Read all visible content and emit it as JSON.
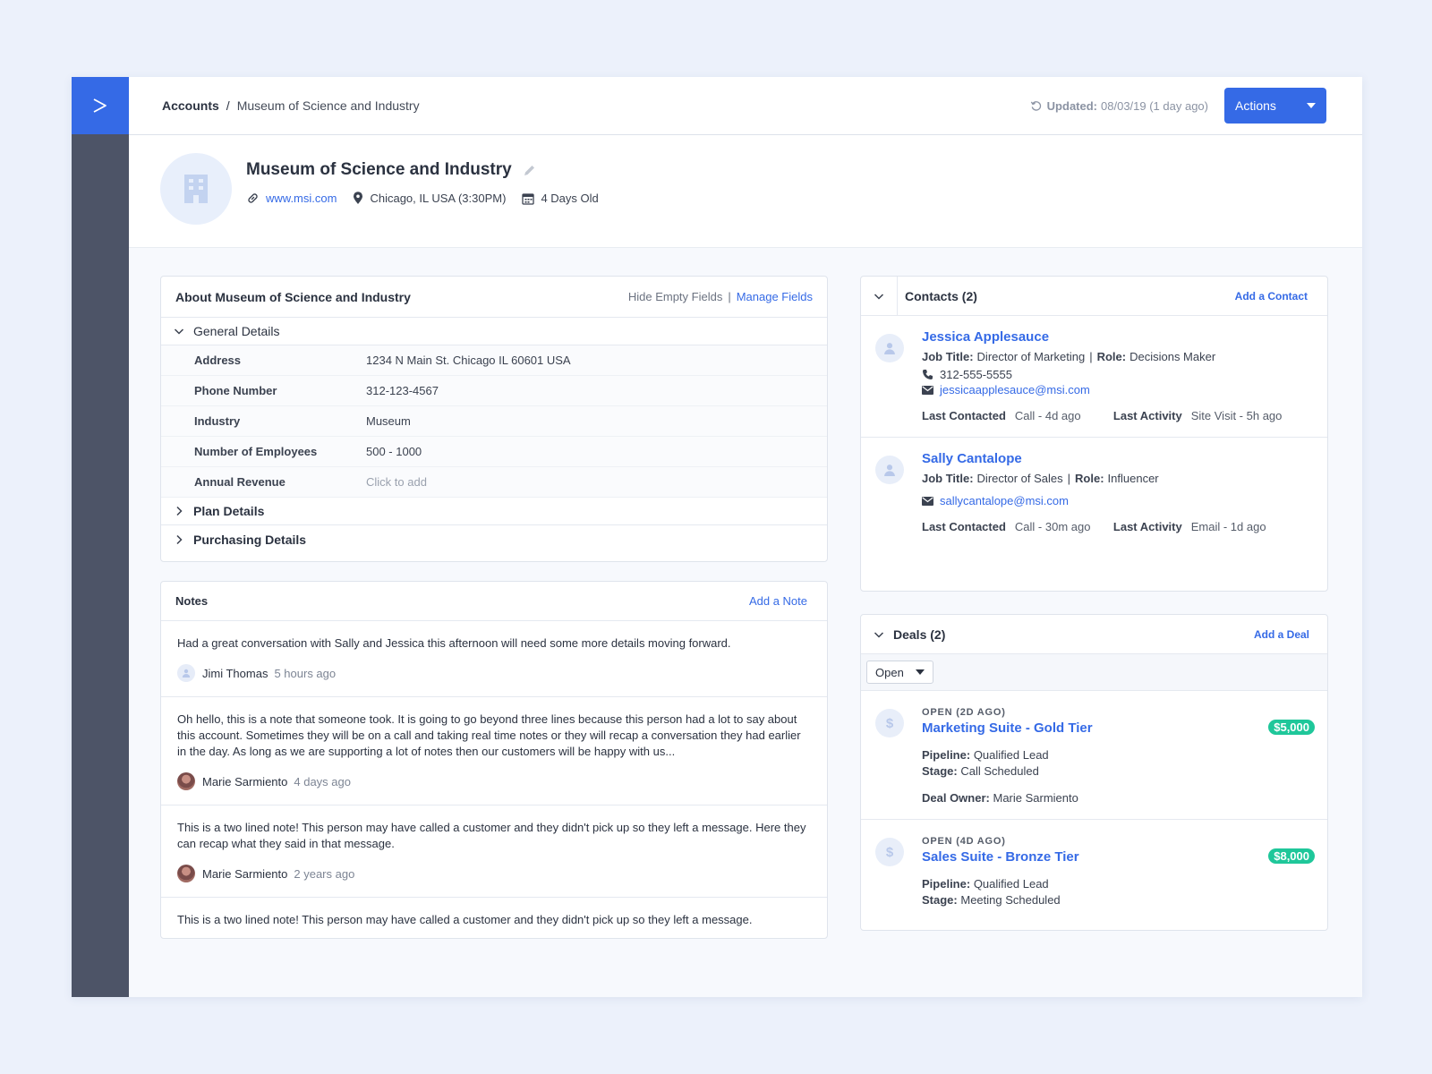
{
  "breadcrumb": {
    "root": "Accounts",
    "separator": "/",
    "current": "Museum of Science and Industry"
  },
  "topbar": {
    "updated_label": "Updated:",
    "updated_value": "08/03/19 (1 day ago)",
    "actions_label": "Actions"
  },
  "account": {
    "name": "Museum of Science and Industry",
    "website": "www.msi.com",
    "location": "Chicago, IL USA (3:30PM)",
    "age": "4 Days Old"
  },
  "about": {
    "title": "About Museum of Science and Industry",
    "hide_empty": "Hide Empty Fields",
    "pipe": "|",
    "manage_fields": "Manage Fields",
    "general_section": "General Details",
    "fields": [
      {
        "label": "Address",
        "value": "1234 N Main St. Chicago IL 60601 USA"
      },
      {
        "label": "Phone Number",
        "value": "312-123-4567"
      },
      {
        "label": "Industry",
        "value": "Museum"
      },
      {
        "label": "Number of Employees",
        "value": "500 - 1000"
      },
      {
        "label": "Annual Revenue",
        "value": "Click to add"
      }
    ],
    "plan_section": "Plan Details",
    "purchasing_section": "Purchasing Details"
  },
  "notes": {
    "title": "Notes",
    "add_label": "Add a Note",
    "items": [
      {
        "text": "Had a great conversation with Sally and Jessica this afternoon will need some more details moving forward.",
        "author": "Jimi Thomas",
        "when": "5 hours ago"
      },
      {
        "text": "Oh hello, this is a note that someone took. It is going to go beyond three lines because this person had a lot to say about this account. Sometimes they will be on a call and taking real time notes or they will recap a conversation they had earlier in the day. As long as we are supporting a lot of notes then our customers will be happy with us...",
        "author": "Marie Sarmiento",
        "when": "4 days ago"
      },
      {
        "text": "This is a two lined note! This person may have called a customer and they didn't pick up so they left a message. Here they can recap what they said in that message.",
        "author": "Marie Sarmiento",
        "when": "2 years ago"
      },
      {
        "text": "This is a two lined note! This person may have called a customer and they didn't pick up so they left a message."
      }
    ]
  },
  "contacts": {
    "title": "Contacts (2)",
    "add_label": "Add a Contact",
    "job_title_label": "Job Title:",
    "role_label": "Role:",
    "pipe": "|",
    "last_contacted_label": "Last Contacted",
    "last_activity_label": "Last Activity",
    "items": [
      {
        "name": "Jessica Applesauce",
        "job_title": "Director of Marketing",
        "role": "Decisions Maker",
        "phone": "312-555-5555",
        "email": "jessicaapplesauce@msi.com",
        "last_contacted": "Call - 4d ago",
        "last_activity": "Site Visit - 5h ago"
      },
      {
        "name": "Sally Cantalope",
        "job_title": "Director of Sales",
        "role": "Influencer",
        "email": "sallycantalope@msi.com",
        "last_contacted": "Call - 30m ago",
        "last_activity": "Email - 1d ago"
      }
    ]
  },
  "deals": {
    "title": "Deals (2)",
    "add_label": "Add a Deal",
    "filter_value": "Open",
    "pipeline_label": "Pipeline:",
    "stage_label": "Stage:",
    "owner_label": "Deal Owner:",
    "items": [
      {
        "status": "OPEN (2D AGO)",
        "name": "Marketing Suite - Gold Tier",
        "amount": "$5,000",
        "pipeline": "Qualified Lead",
        "stage": "Call Scheduled",
        "owner": "Marie Sarmiento"
      },
      {
        "status": "OPEN (4D AGO)",
        "name": "Sales Suite - Bronze Tier",
        "amount": "$8,000",
        "pipeline": "Qualified Lead",
        "stage": "Meeting Scheduled"
      }
    ]
  },
  "icons": [
    "logo-icon",
    "refresh-icon",
    "building-icon",
    "pencil-icon",
    "link-icon",
    "location-pin-icon",
    "calendar-icon",
    "chevron-down-icon",
    "chevron-right-icon",
    "user-icon",
    "phone-icon",
    "email-icon",
    "dollar-icon"
  ],
  "colors": {
    "accent": "#356ae6",
    "rail": "#4d5467",
    "amount_badge": "#1fc79a",
    "background": "#ecf1fb"
  }
}
